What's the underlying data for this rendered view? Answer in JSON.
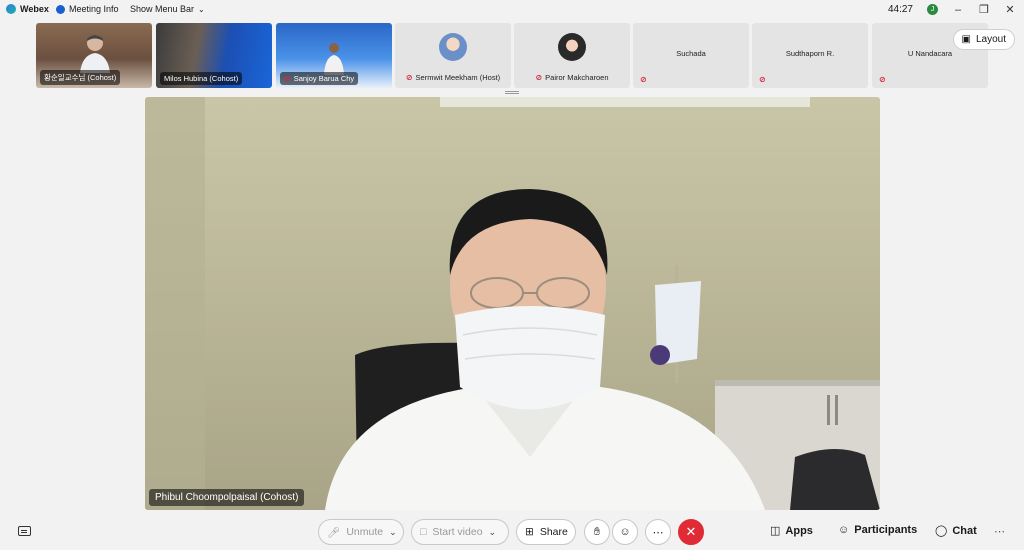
{
  "titlebar": {
    "app_name": "Webex",
    "meeting_info": "Meeting Info",
    "show_menu_bar": "Show Menu Bar",
    "timer": "44:27",
    "badge_initial": "J"
  },
  "participants_strip": [
    {
      "name": "황순일교수님 (Cohost)",
      "video": true
    },
    {
      "name": "Milos Hubina (Cohost)",
      "video": true
    },
    {
      "name": "Sanjoy Barua Chy",
      "video": true,
      "muted": true
    },
    {
      "name": "Sermwit Meekham (Host)",
      "video": false,
      "muted": true
    },
    {
      "name": "Pairor Makcharoen",
      "video": false,
      "muted": true
    },
    {
      "name": "Suchada",
      "video": false,
      "muted": true
    },
    {
      "name": "Sudthaporn R.",
      "video": false,
      "muted": true
    },
    {
      "name": "U Nandacara",
      "video": false,
      "muted": true
    }
  ],
  "layout_button": "Layout",
  "main_video": {
    "speaker": "Phibul Choompolpaisal (Cohost)"
  },
  "toolbar": {
    "unmute": "Unmute",
    "start_video": "Start video",
    "share": "Share",
    "apps": "Apps",
    "participants": "Participants",
    "chat": "Chat"
  },
  "colors": {
    "end_call": "#e02a35",
    "muted_icon": "#d6263b",
    "background": "#f2f2f2"
  }
}
